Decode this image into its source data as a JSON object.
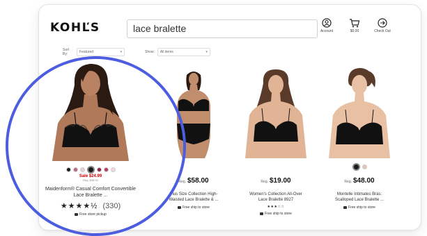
{
  "header": {
    "logo": "KOHĽS",
    "search_value": "lace bralette",
    "icons": [
      {
        "name": "account-icon",
        "label": "Account"
      },
      {
        "name": "cart-icon",
        "label": "$0.00"
      },
      {
        "name": "check-out-icon",
        "label": "Check Out"
      }
    ]
  },
  "filters": {
    "sort_label": "Sort By:",
    "sort_value": "Featured",
    "show_label": "Show:",
    "show_value": "All items"
  },
  "products": [
    {
      "id": "featured",
      "sale_price": "Sale $24.99",
      "reg_price": "Reg. $38.00",
      "name": "Maidenform® Casual Comfort Convertible Lace Bralette ...",
      "stars": "★★★★½",
      "rating_count": "(330)",
      "pickup": "Free store pickup",
      "swatches": [
        "#1a1a1a",
        "#b86a7c",
        "#e8cdd1",
        "#1a1a1a",
        "#8b1f4d",
        "#b43c6a",
        "#f0d8dc"
      ]
    },
    {
      "id": "p2",
      "price_prefix": "Reg.",
      "price": "$58.00",
      "name": "Plus Size Collection High-Waisted Lace Bralette & ...",
      "pickup": "Free ship to store"
    },
    {
      "id": "p3",
      "price_prefix": "Reg.",
      "price": "$19.00",
      "name": "Women's Collection All-Over Lace Bralette 8927",
      "stars": "★★★☆☆",
      "pickup": "Free ship to store"
    },
    {
      "id": "p4",
      "price_prefix": "Reg.",
      "price": "$48.00",
      "name": "Montelle Intimates Bras: Scalloped Lace Bralette ...",
      "pickup": "Free ship to store",
      "swatches": [
        "#1a1a1a",
        "#e6c2b4"
      ]
    }
  ],
  "colors": {
    "highlight": "#4c5de0",
    "sale_red": "#cc0000",
    "bra_black": "#111111",
    "skin_dark": "#b07a5a",
    "skin_light": "#e5b89c",
    "hair_dark": "#2a1a12",
    "hair_brown": "#5a3a28"
  }
}
